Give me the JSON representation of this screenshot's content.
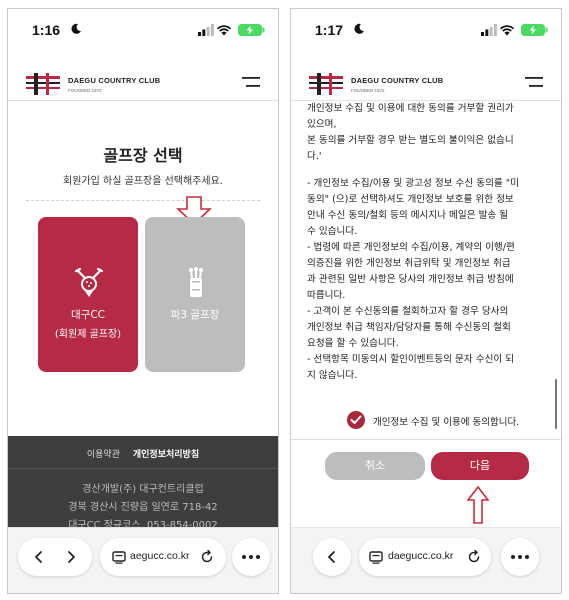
{
  "left": {
    "status": {
      "time": "1:16"
    },
    "header": {
      "brand": "DAEGU COUNTRY CLUB",
      "founded": "FOUNDED 1972"
    },
    "title": "골프장 선택",
    "description": "회원가입 하실 골프장을 선택해주세요.",
    "cards": [
      {
        "line1": "대구CC",
        "line2": "(회원제 골프장)",
        "icon": "golf-ball-clubs-icon",
        "color": "#b52b45"
      },
      {
        "line1": "파3 골프장",
        "line2": "",
        "icon": "golf-bag-icon",
        "color": "#bdbdbd"
      }
    ],
    "footer": {
      "links": [
        "이용약관",
        "개인정보처리방침"
      ],
      "lines": [
        "경산개발(주) 대구컨트리클럽",
        "경북 경산시 진량읍 일연로 718-42",
        "대구CC 정규코스. 053-854-0002"
      ]
    },
    "browser": {
      "url": "aegucc.co.kr"
    }
  },
  "right": {
    "status": {
      "time": "1:17"
    },
    "header": {
      "brand": "DAEGU COUNTRY CLUB",
      "founded": "FOUNDED 1972"
    },
    "terms_lines": [
      "개인정보 수집 및 이용에 대한 동의를 거부할 권리가",
      "있으며,",
      "본 동의를 거부할 경우 받는 별도의 불이익은 없습니",
      "다.'",
      "",
      "- 개인정보 수집/이용 및 광고성 정보 수신 동의를 \"미",
      "동의\" (으)로 선택하셔도 개인정보 보호를 위한 정보",
      "안내 수신 동의/철회 등의 메시지나 메일은 발송 될",
      "수 있습니다.",
      "- 법령에 따른 개인정보의 수집/이용, 계약의 이행/편",
      "의증진을 위한 개인정보 취급위탁 및 개인정보 취급",
      "과 관련된 일반 사항은 당사의 개인정보 취급 방침에",
      "따릅니다.",
      "- 고객이 본 수신동의를 철회하고자 할 경우 당사의",
      "개인정보 취급 책임자/담당자를 통해 수신동의 철회",
      "요청을 할 수 있습니다.",
      "- 선택항목 미동의시 할인이벤트등의 문자 수신이 되",
      "지 않습니다."
    ],
    "agree_label": "개인정보 수집 및 이용에 동의합니다.",
    "buttons": {
      "cancel": "취소",
      "next": "다음"
    },
    "browser": {
      "url": "daegucc.co.kr"
    }
  },
  "colors": {
    "brand": "#b52b45",
    "muted": "#bdbdbd",
    "footer": "#3e3e3e"
  }
}
